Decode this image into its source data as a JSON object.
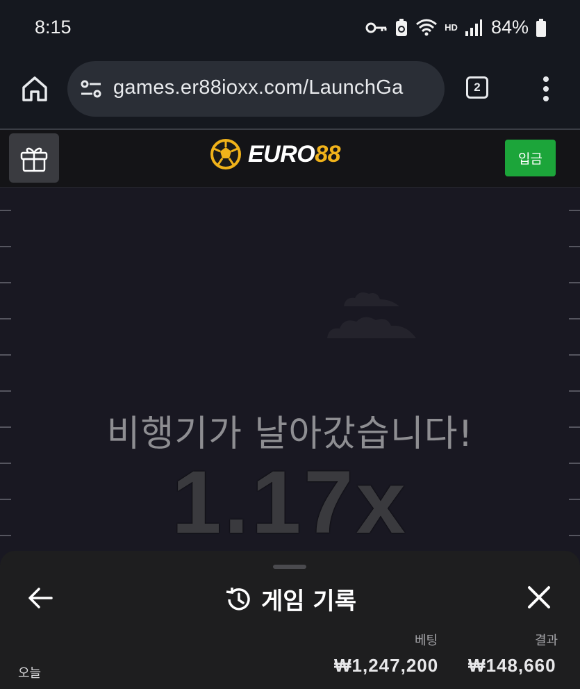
{
  "status_bar": {
    "time": "8:15",
    "network": "HD",
    "battery": "84%",
    "icons": [
      "key-icon",
      "lock-screen-icon",
      "wifi-icon",
      "signal-icon",
      "battery-icon"
    ]
  },
  "browser": {
    "url": "games.er88ioxx.com/LaunchGa",
    "tab_count": "2",
    "icons": [
      "home-icon",
      "site-settings-icon",
      "more-menu-icon"
    ]
  },
  "site_header": {
    "logo_word": "EURO",
    "logo_number": "88",
    "deposit_label": "입금",
    "icons": [
      "gift-icon",
      "soccer-ball-logo-icon"
    ],
    "brand_color": "#f0b21a",
    "deposit_color": "#1ca53a"
  },
  "game": {
    "flew_away_text": "비행기가 날아갔습니다!",
    "multiplier": "1.17x"
  },
  "history_sheet": {
    "title": "게임 기록",
    "bet_header": "베팅",
    "result_header": "결과",
    "rows": [
      {
        "label": "오늘",
        "bet": "₩1,247,200",
        "result": "₩148,660"
      }
    ],
    "icons": [
      "back-arrow-icon",
      "history-icon",
      "close-icon"
    ]
  }
}
